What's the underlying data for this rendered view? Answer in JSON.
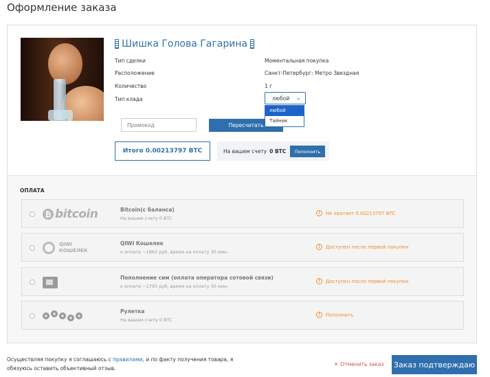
{
  "page": {
    "title": "Оформление заказа"
  },
  "product": {
    "name": "Шишка Голова Гагарина",
    "details": [
      {
        "label": "Тип сделки",
        "value": "Моментальная покупка"
      },
      {
        "label": "Расположение",
        "value": "Санкт-Петербург: Метро Звездная"
      },
      {
        "label": "Количество",
        "value": "1 г"
      },
      {
        "label": "Тип клада",
        "value": ""
      }
    ],
    "klad_select": {
      "selected": "любой",
      "options": [
        "любой",
        "Тайник"
      ]
    }
  },
  "promo": {
    "placeholder": "Промокод",
    "recalc_label": "Пересчитать"
  },
  "total": {
    "label": "Итого 0.00213797 BTC"
  },
  "balance": {
    "label": "На вашем счету",
    "amount": "0 BTC",
    "topup_label": "Пополнить"
  },
  "payment": {
    "heading": "ОПЛАТА",
    "methods": [
      {
        "logo": "bitcoin-logo",
        "logo_text": "bitcoin",
        "title": "Bitcoin(с баланса)",
        "sub": "На вашем счету 0 BTC",
        "status": "Не хватает 0.00213797 BTC"
      },
      {
        "logo": "qiwi-logo",
        "logo_text_1": "QIWI",
        "logo_text_2": "КОШЕЛЕК",
        "title": "QIWI Кошелек",
        "sub": "к оплате ~1862 руб, время на оплату 30 мин.",
        "status": "Доступен после первой покупки"
      },
      {
        "logo": "sim-icon",
        "title": "Пополнение сим (оплата оператора сотовой связи)",
        "sub": "к оплате ~1795 руб, время на оплату 30 мин.",
        "status": "Доступен после первой покупки"
      },
      {
        "logo": "gears-icon",
        "title": "Рулетка",
        "sub": "На вашем счету 0 BTC",
        "status": "Пополнить"
      }
    ]
  },
  "footer": {
    "text_before": "Осуществляя покупку я соглашаюсь с ",
    "rules_link": "правилами",
    "text_after": ", и по факту получения товара, я обязуюсь оставить объективный отзыв.",
    "cancel_label": "Отменить заказ",
    "confirm_label": "Заказ подтверждаю"
  },
  "colors": {
    "accent": "#2f6fad",
    "warning": "#f08c2a",
    "cancel": "#d9534f"
  }
}
